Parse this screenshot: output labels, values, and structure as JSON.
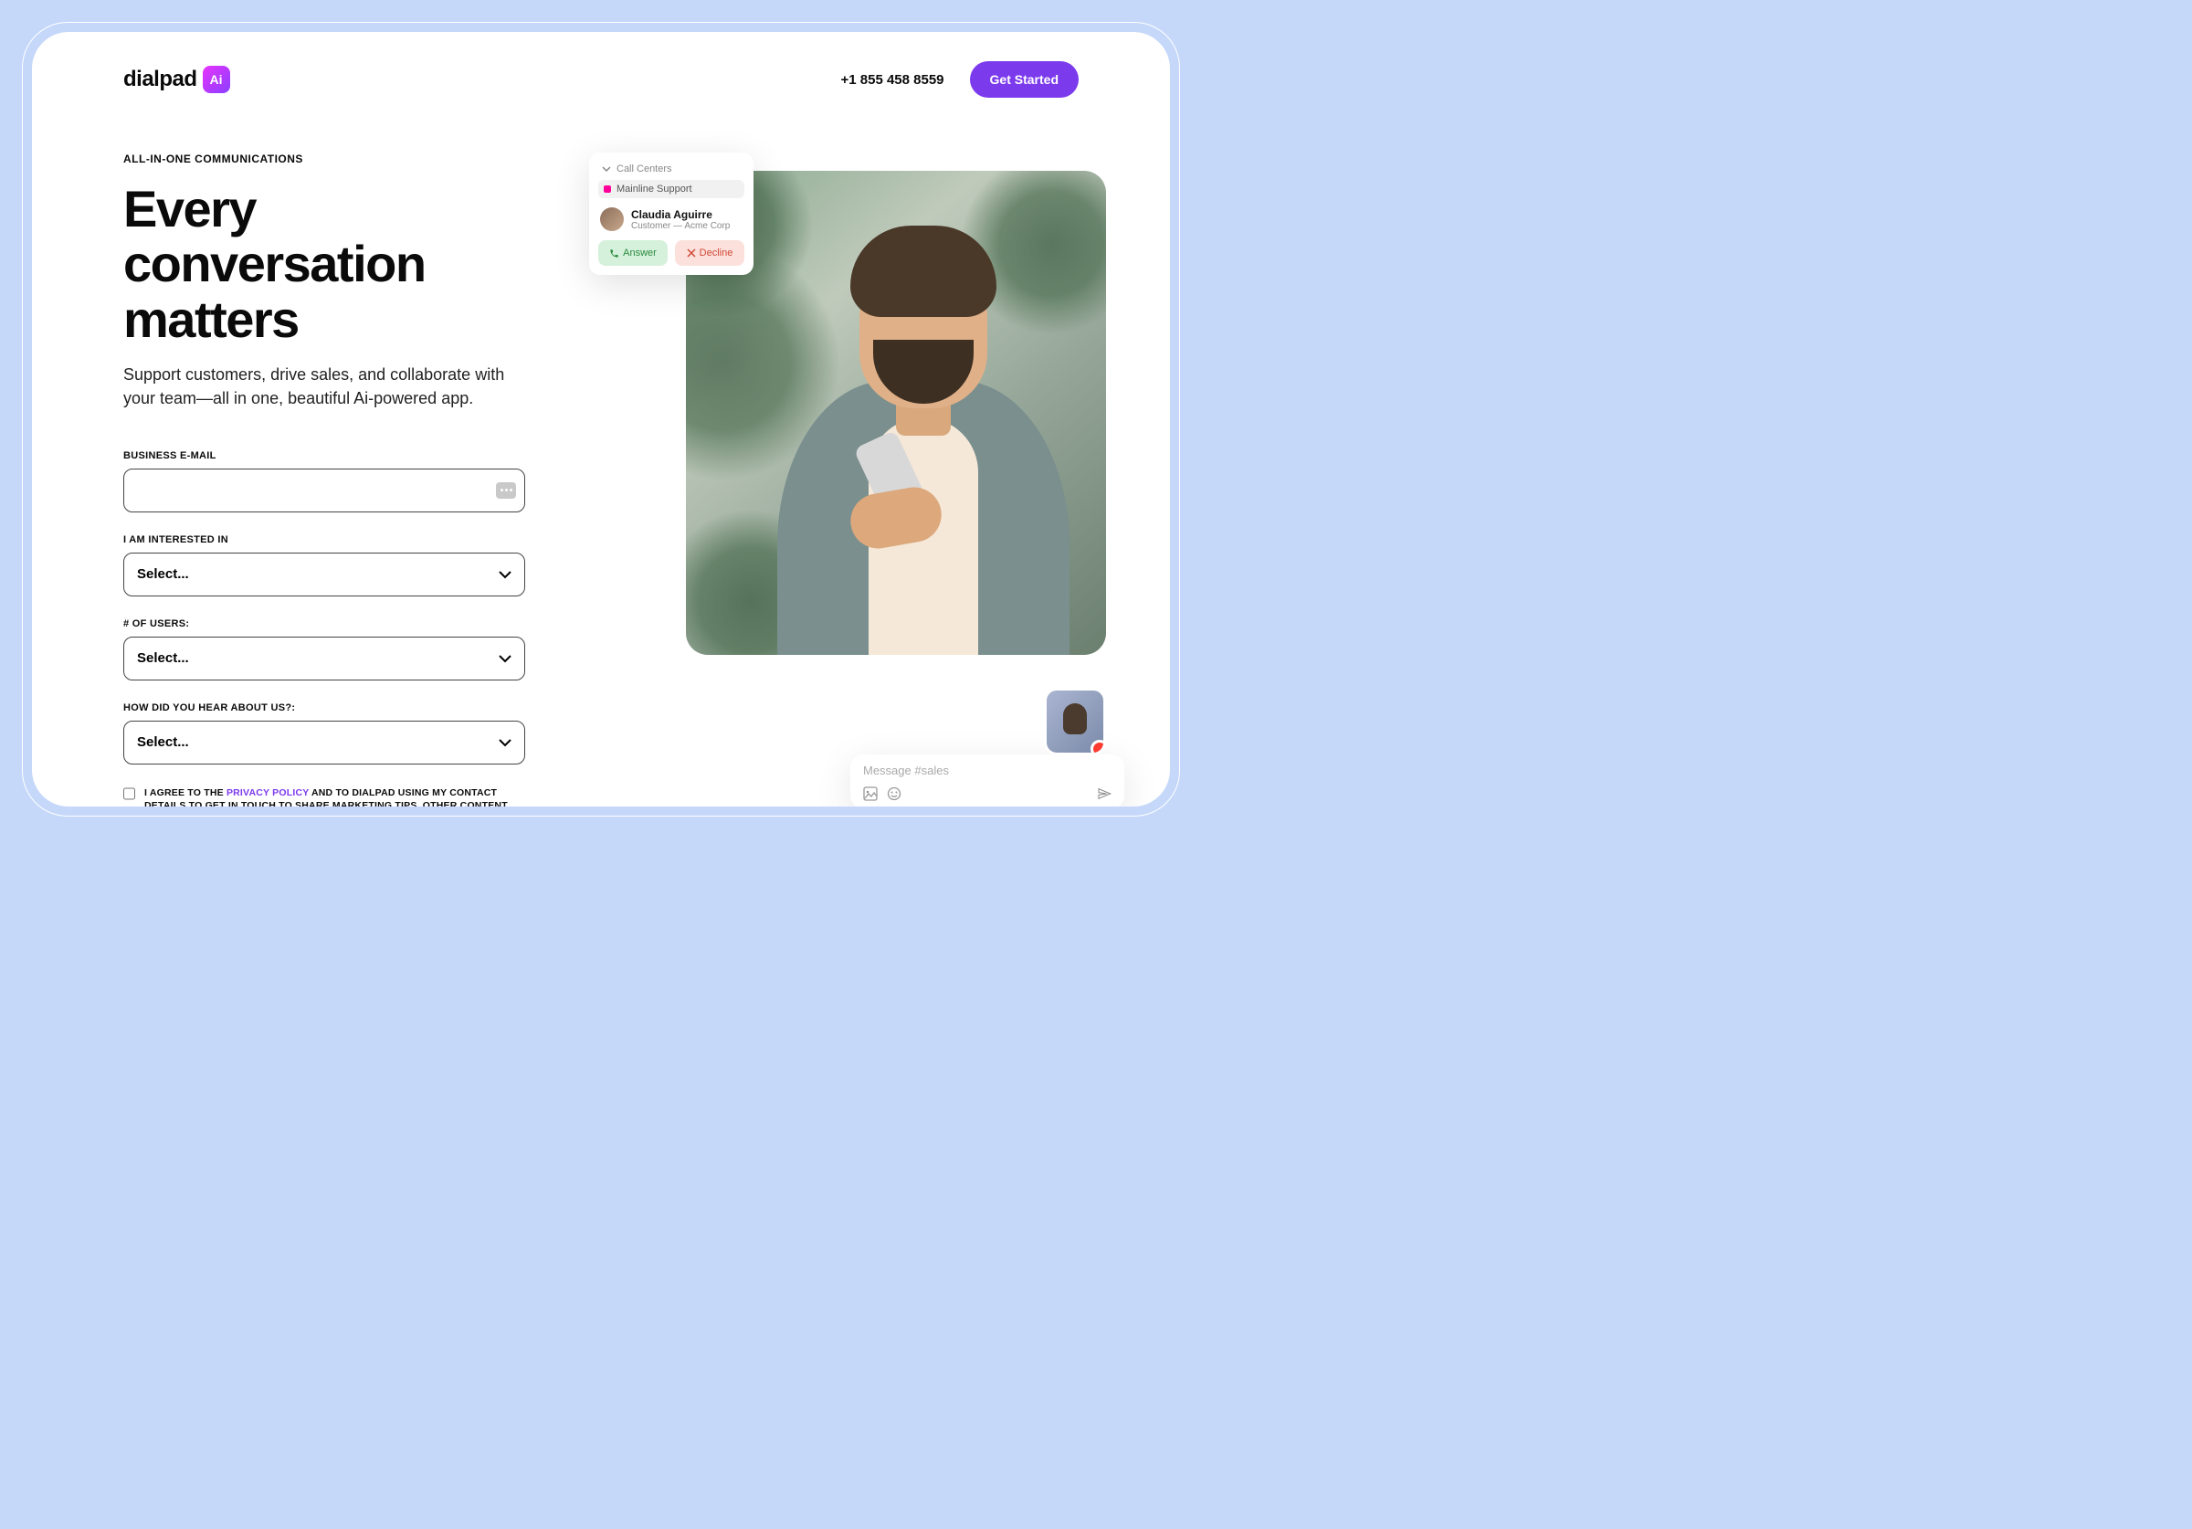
{
  "header": {
    "logo_text": "dialpad",
    "logo_badge": "Ai",
    "phone": "+1 855 458 8559",
    "cta": "Get Started"
  },
  "hero": {
    "eyebrow": "ALL-IN-ONE COMMUNICATIONS",
    "headline": "Every conversation matters",
    "subhead": "Support customers, drive sales, and collaborate with your team—all in one, beautiful Ai-powered app."
  },
  "form": {
    "email_label": "BUSINESS E-MAIL",
    "email_value": "",
    "interest_label": "I AM INTERESTED IN",
    "interest_placeholder": "Select...",
    "users_label": "# OF USERS:",
    "users_placeholder": "Select...",
    "hear_label": "HOW DID YOU HEAR ABOUT US?:",
    "hear_placeholder": "Select...",
    "consent_pre": "I AGREE TO THE ",
    "consent_link": "PRIVACY POLICY",
    "consent_post": " AND TO DIALPAD USING MY CONTACT DETAILS TO GET IN TOUCH TO SHARE MARKETING TIPS, OTHER CONTENT, AND THE LATEST OFFERS."
  },
  "call_popup": {
    "section": "Call Centers",
    "queue": "Mainline Support",
    "caller_name": "Claudia Aguirre",
    "caller_sub": "Customer — Acme Corp",
    "answer": "Answer",
    "decline": "Decline"
  },
  "message_bar": {
    "placeholder": "Message #sales"
  }
}
